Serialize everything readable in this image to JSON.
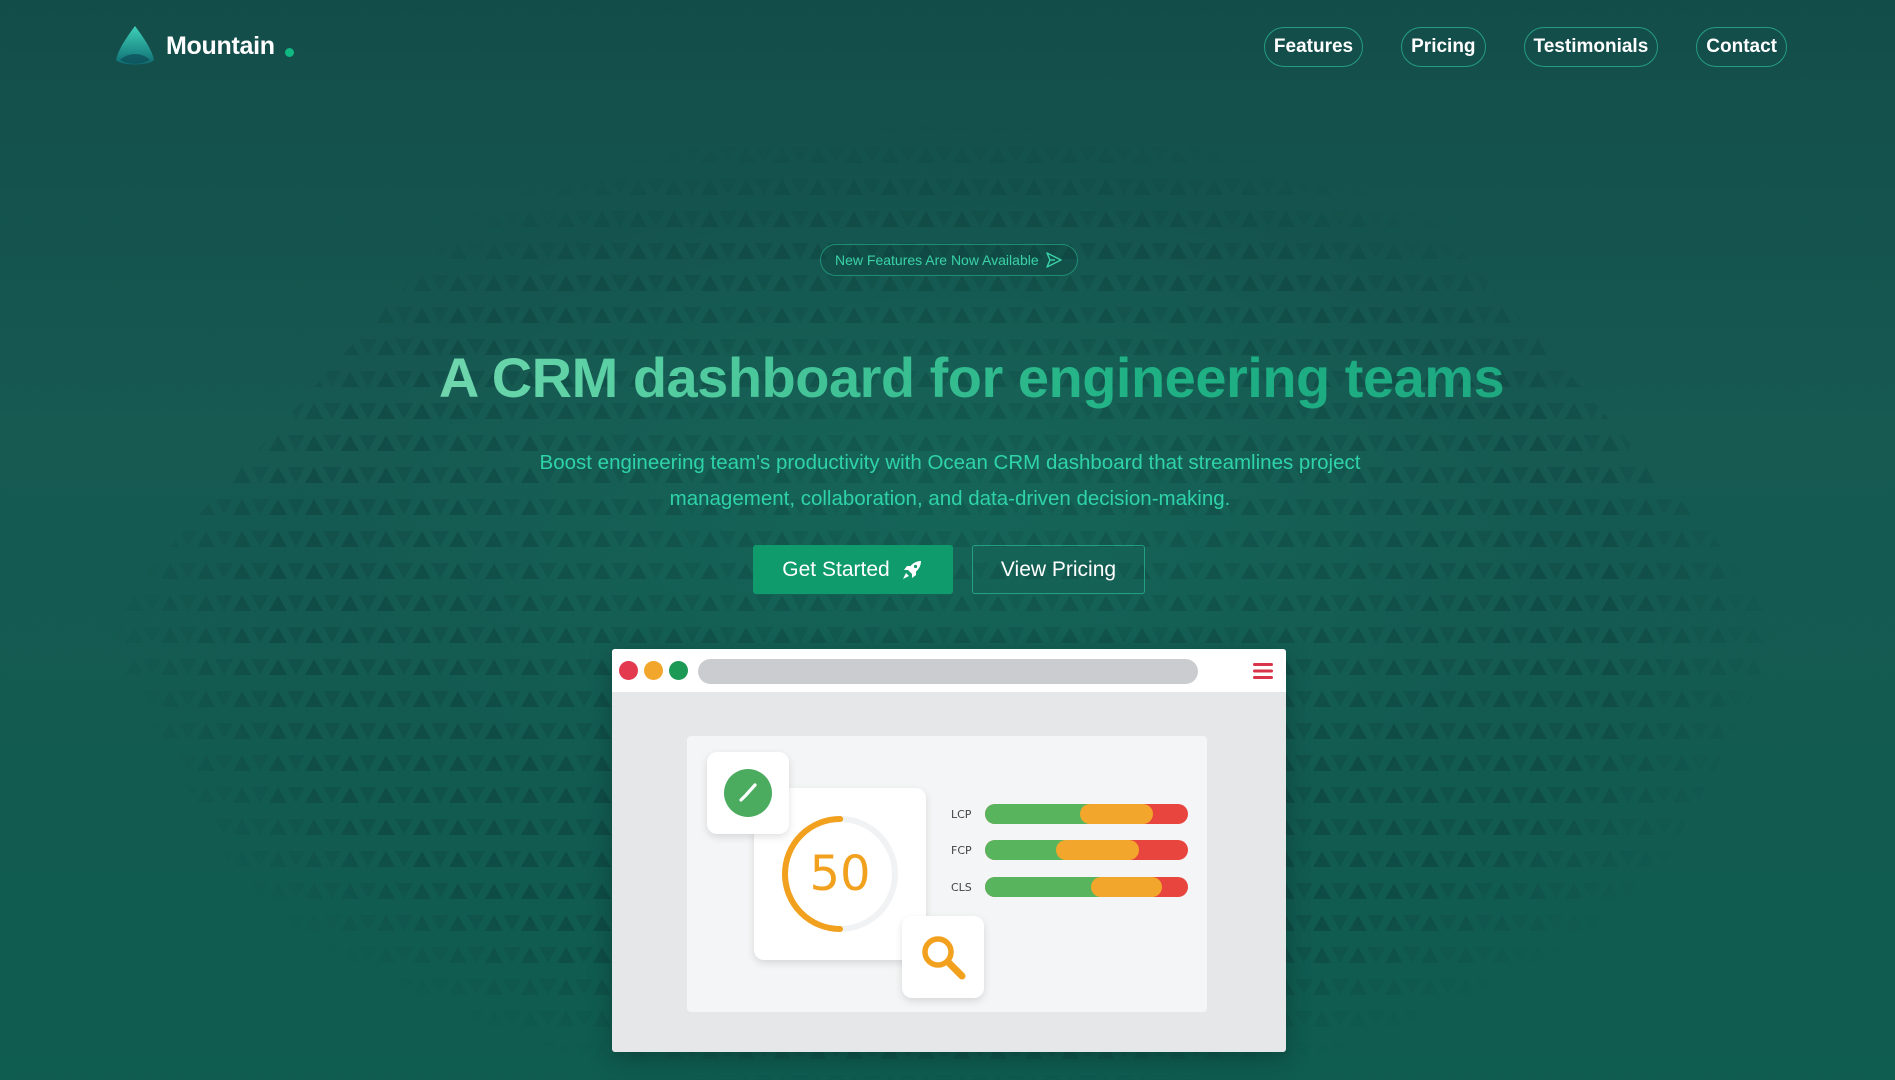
{
  "nav": {
    "brand": "Mountain",
    "links": [
      "Features",
      "Pricing",
      "Testimonials",
      "Contact"
    ]
  },
  "hero": {
    "badge": "New Features Are Now Available",
    "headline": "A CRM dashboard for engineering teams",
    "subtitle": "Boost engineering team's productivity with Ocean CRM dashboard that streamlines project management, collaboration, and data-driven decision-making.",
    "primary_button": "Get Started",
    "secondary_button": "View Pricing"
  },
  "preview": {
    "score": "50",
    "metrics": [
      {
        "label": "LCP",
        "good": 0.47,
        "mid_end": 0.83
      },
      {
        "label": "FCP",
        "good": 0.35,
        "mid_end": 0.76
      },
      {
        "label": "CLS",
        "good": 0.52,
        "mid_end": 0.87
      }
    ],
    "score_fraction": 0.5
  },
  "icons": {
    "logo": "mountain-logo-icon",
    "badge": "send-arrow-icon",
    "primary_button": "rocket-icon",
    "menu": "hamburger-menu-icon",
    "check": "check-circle-icon",
    "search": "magnifier-icon"
  },
  "colors": {
    "background": "#155650",
    "accent": "#0f9b6b",
    "accent_text": "#2fd3a9",
    "score": "#f2a11f",
    "good": "#58b55e",
    "needs_improvement": "#f2a62b",
    "poor": "#e7453d"
  }
}
